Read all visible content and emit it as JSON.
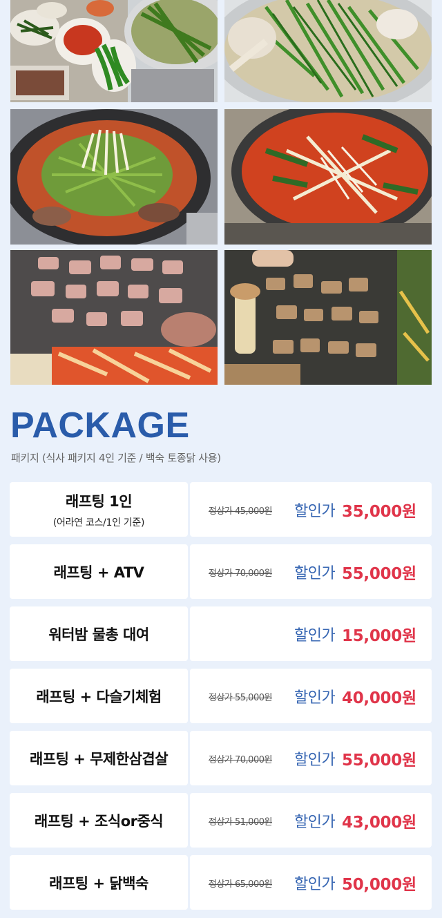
{
  "section": {
    "title": "PACKAGE",
    "subtitle": "패키지 (식사 패키지 4인 기준 / 백숙 토종닭 사용)"
  },
  "photos": [
    {
      "icon": "side-dishes-table-photo"
    },
    {
      "icon": "chives-hotpot-photo"
    },
    {
      "icon": "spicy-fish-stew-photo"
    },
    {
      "icon": "spicy-stew-mushroom-photo"
    },
    {
      "icon": "grilled-pork-kimchi-photo"
    },
    {
      "icon": "grilled-pork-belly-photo"
    }
  ],
  "packages": [
    {
      "name": "래프팅 1인",
      "note": "(어라연 코스/1인 기준)",
      "original": "정상가 45,000원",
      "sale_label": "할인가",
      "sale_price": "35,000원"
    },
    {
      "name": "래프팅 + ATV",
      "note": "",
      "original": "정상가 70,000원",
      "sale_label": "할인가",
      "sale_price": "55,000원"
    },
    {
      "name": "워터밤 물총 대여",
      "note": "",
      "original": "",
      "sale_label": "할인가",
      "sale_price": "15,000원"
    },
    {
      "name": "래프팅 + 다슬기체험",
      "note": "",
      "original": "정상가 55,000원",
      "sale_label": "할인가",
      "sale_price": "40,000원"
    },
    {
      "name": "래프팅 + 무제한삼겹살",
      "note": "",
      "original": "정상가 70,000원",
      "sale_label": "할인가",
      "sale_price": "55,000원"
    },
    {
      "name": "래프팅 + 조식or중식",
      "note": "",
      "original": "정상가 51,000원",
      "sale_label": "할인가",
      "sale_price": "43,000원"
    },
    {
      "name": "래프팅 + 닭백숙",
      "note": "",
      "original": "정상가 65,000원",
      "sale_label": "할인가",
      "sale_price": "50,000원"
    }
  ],
  "colors": {
    "background": "#eaf1fb",
    "heading": "#2a5caa",
    "sale_label": "#3867b3",
    "sale_price": "#e0354a"
  }
}
